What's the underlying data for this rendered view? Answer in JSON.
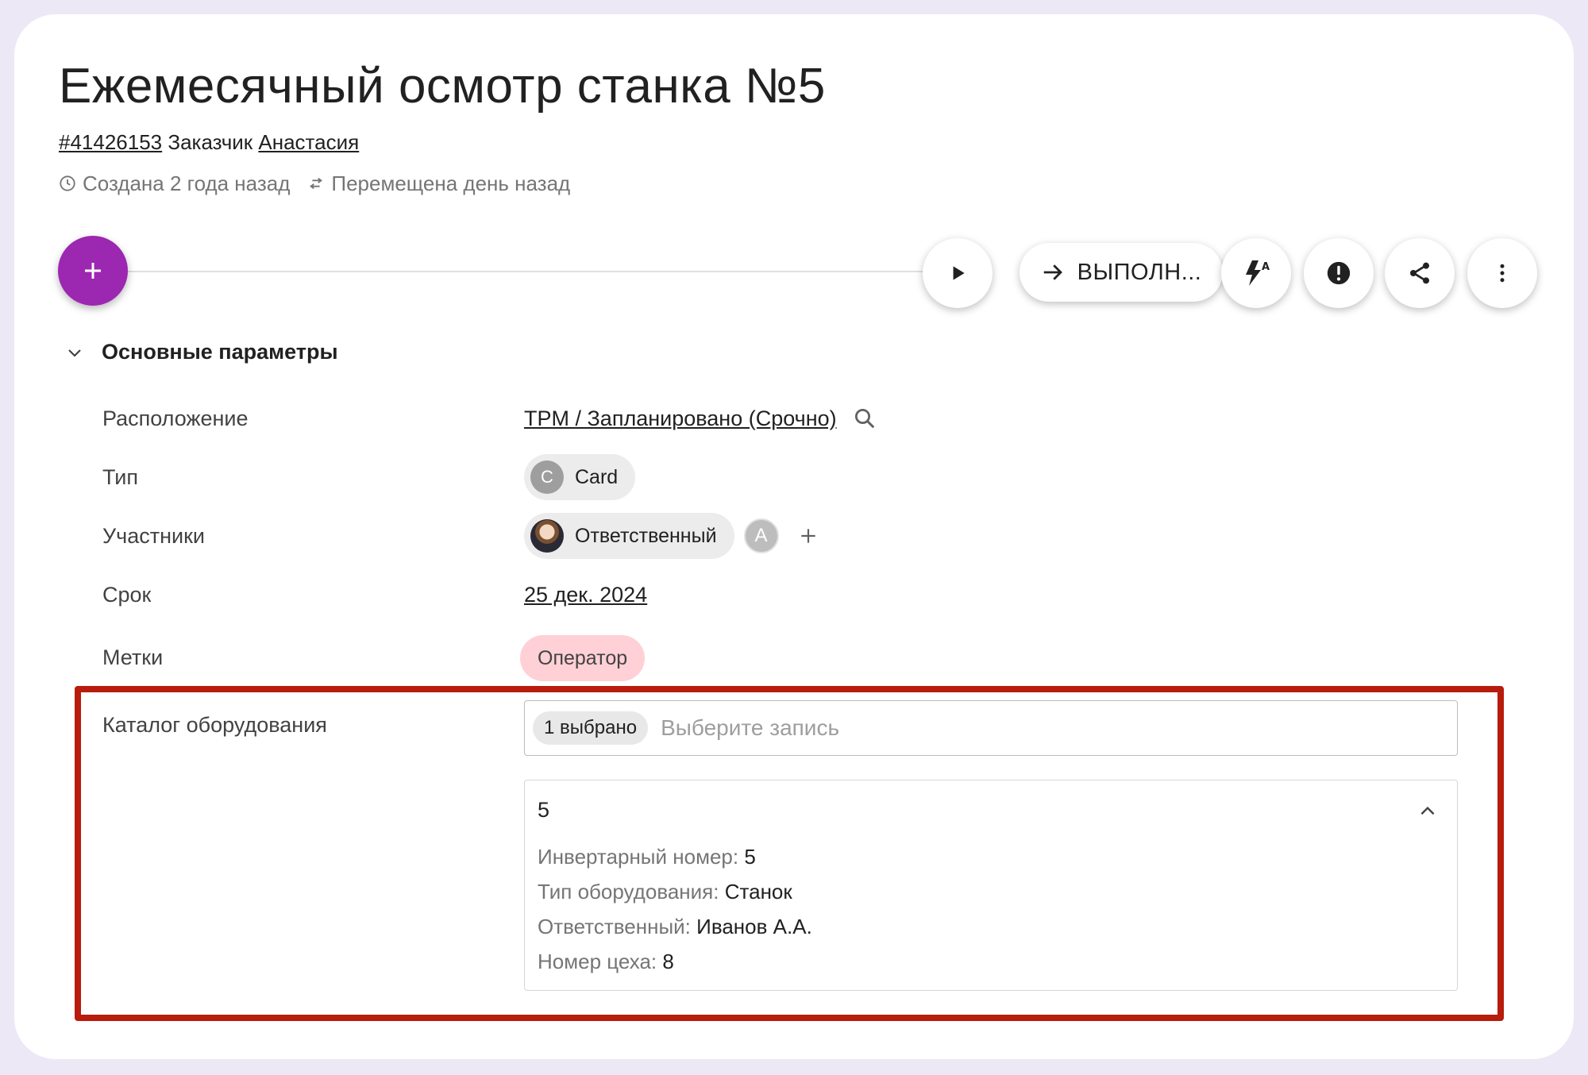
{
  "header": {
    "title": "Ежемесячный осмотр станка №5",
    "id_link": "#41426153",
    "customer_label": "Заказчик",
    "customer_link": "Анастасия",
    "created": "Создана 2 года назад",
    "moved": "Перемещена день назад"
  },
  "toolbar": {
    "add_label": "+",
    "status_button": "ВЫПОЛН...",
    "icons": [
      "play-icon",
      "arrow-right-icon",
      "automation-bolt-icon",
      "alert-icon",
      "share-icon",
      "more-vert-icon"
    ]
  },
  "section": {
    "title": "Основные параметры",
    "fields": {
      "location": {
        "label": "Расположение",
        "value": "TPM / Запланировано (Срочно)"
      },
      "type": {
        "label": "Тип",
        "avatar_letter": "C",
        "value": "Card"
      },
      "participants": {
        "label": "Участники",
        "responsible_chip": "Ответственный",
        "extra_avatar": "A",
        "add_label": "+"
      },
      "deadline": {
        "label": "Срок",
        "value": "25 дек. 2024"
      },
      "tags": {
        "label": "Метки",
        "value": "Оператор"
      },
      "catalog": {
        "label": "Каталог оборудования",
        "selected_count": "1 выбрано",
        "placeholder": "Выберите запись",
        "record": {
          "title": "5",
          "lines": [
            {
              "key": "Инвертарный номер:",
              "value": "5"
            },
            {
              "key": "Тип оборудования:",
              "value": "Станок"
            },
            {
              "key": "Ответственный:",
              "value": "Иванов А.А."
            },
            {
              "key": "Номер цеха:",
              "value": "8"
            }
          ]
        }
      }
    }
  },
  "colors": {
    "fab": "#9c27b0",
    "tag_bg": "#ffd0d6",
    "highlight": "#b71c0c",
    "page_bg": "#ece8f6"
  }
}
